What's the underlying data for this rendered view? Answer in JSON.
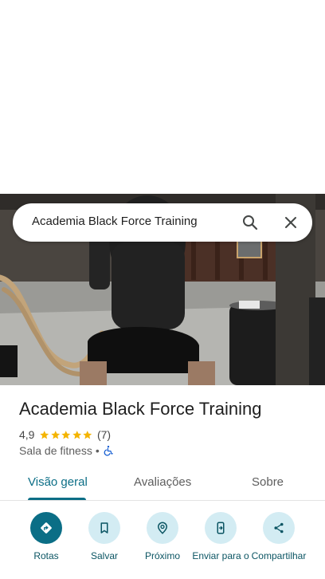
{
  "search": {
    "query": "Academia Black Force Training"
  },
  "place": {
    "name": "Academia Black Force Training",
    "rating": "4,9",
    "review_count": "(7)",
    "stars": 5,
    "category": "Sala de fitness",
    "separator": "•"
  },
  "tabs": [
    {
      "label": "Visão geral",
      "active": true
    },
    {
      "label": "Avaliações",
      "active": false
    },
    {
      "label": "Sobre",
      "active": false
    }
  ],
  "actions": [
    {
      "label": "Rotas",
      "icon": "directions-icon"
    },
    {
      "label": "Salvar",
      "icon": "bookmark-icon"
    },
    {
      "label": "Próximo",
      "icon": "nearby-icon"
    },
    {
      "label": "Enviar para o",
      "icon": "send-to-phone-icon"
    },
    {
      "label": "Compartilhar",
      "icon": "share-icon"
    }
  ],
  "colors": {
    "accent": "#0b6e86",
    "action_circle": "#d3ecf3",
    "star": "#f4b400"
  }
}
